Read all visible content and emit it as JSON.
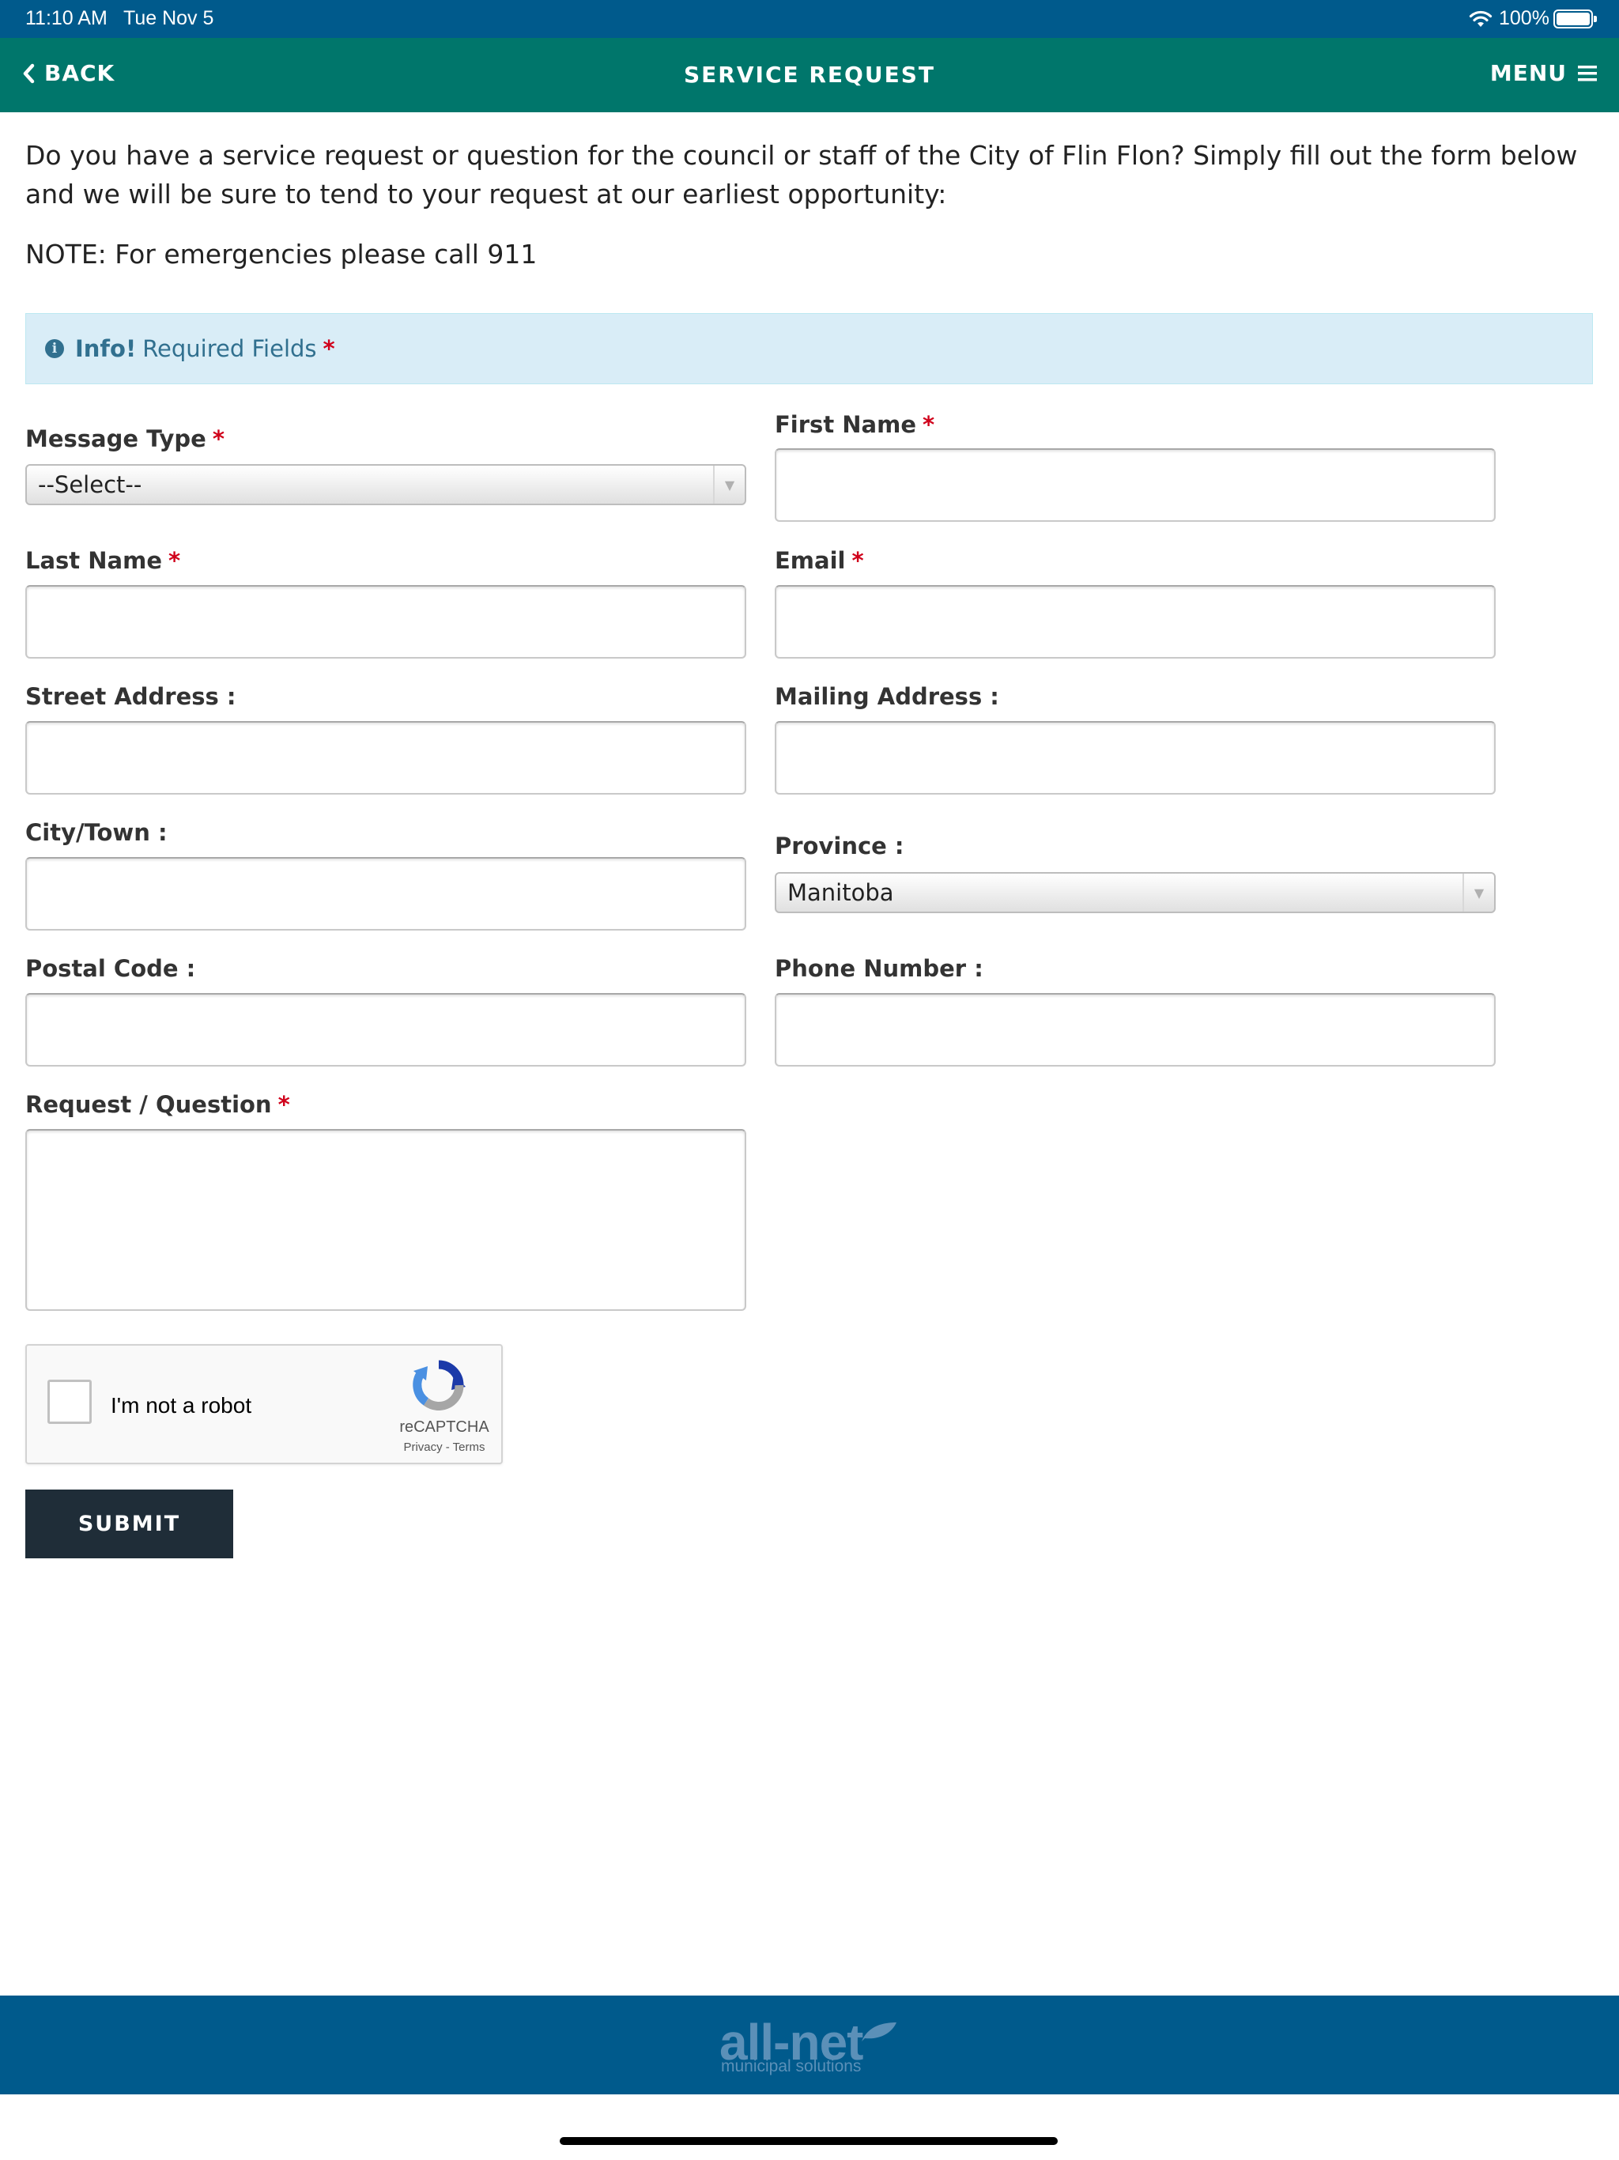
{
  "status_bar": {
    "time": "11:10 AM",
    "date": "Tue Nov 5",
    "battery": "100%"
  },
  "nav": {
    "back_label": "BACK",
    "title": "SERVICE REQUEST",
    "menu_label": "MENU"
  },
  "intro": {
    "text": "Do you have a service request or question for the council or staff of the City of Flin Flon? Simply fill out the form below and we will be sure to tend to your request at our earliest opportunity:",
    "note": "NOTE: For emergencies please call 911"
  },
  "alert": {
    "strong": "Info!",
    "text": "Required Fields",
    "required_mark": "*"
  },
  "form": {
    "required_mark": "*",
    "message_type": {
      "label": "Message Type",
      "value": "--Select--"
    },
    "first_name": {
      "label": "First Name",
      "value": ""
    },
    "last_name": {
      "label": "Last Name",
      "value": ""
    },
    "email": {
      "label": "Email",
      "value": ""
    },
    "street_address": {
      "label": "Street Address :",
      "value": ""
    },
    "mailing_address": {
      "label": "Mailing Address :",
      "value": ""
    },
    "city_town": {
      "label": "City/Town :",
      "value": ""
    },
    "province": {
      "label": "Province :",
      "value": "Manitoba"
    },
    "postal_code": {
      "label": "Postal Code :",
      "value": ""
    },
    "phone_number": {
      "label": "Phone Number :",
      "value": ""
    },
    "request_question": {
      "label": "Request / Question",
      "value": ""
    }
  },
  "captcha": {
    "label": "I'm not a robot",
    "brand": "reCAPTCHA",
    "links": "Privacy - Terms"
  },
  "submit_label": "SUBMIT",
  "footer": {
    "logo": "all-net",
    "tagline": "municipal solutions"
  },
  "colors": {
    "status_bar": "#005a8c",
    "nav_bar": "#00766b",
    "footer": "#005a8c",
    "submit": "#1f2d38",
    "required": "#d0021b",
    "alert_bg": "#d9edf7"
  }
}
